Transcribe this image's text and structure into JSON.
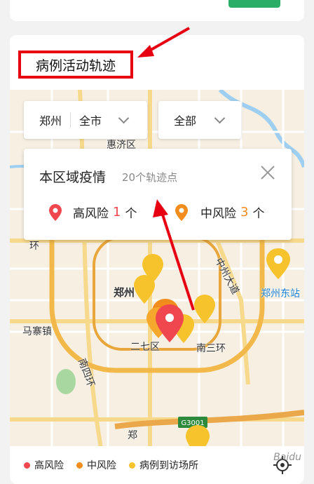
{
  "section": {
    "title": "病例活动轨迹"
  },
  "filters": {
    "city": "郑州",
    "area": "全市",
    "scope": "全部"
  },
  "info_card": {
    "title": "本区域疫情",
    "subtitle": "20个轨迹点",
    "high_label": "高风险",
    "high_count": "1",
    "medium_label": "中风险",
    "medium_count": "3",
    "unit": "个"
  },
  "map_labels": {
    "huiji": "惠济区",
    "zhengzhou": "郑州",
    "zhengzhou_east": "郑州东站",
    "mazhai": "马寨镇",
    "erqi": "二七区",
    "south_third_ring": "南三环",
    "south_fourth_ring": "南四环",
    "huan": "环",
    "zhongzhou": "中州大道",
    "highway": "G3001",
    "zheng": "郑"
  },
  "legend": {
    "high": "高风险",
    "medium": "中风险",
    "visited": "病例到访场所"
  },
  "colors": {
    "high": "#f0464d",
    "medium": "#f28c1c",
    "visited": "#f6c32c",
    "annotation": "#e60012"
  },
  "watermark": "Baidu"
}
